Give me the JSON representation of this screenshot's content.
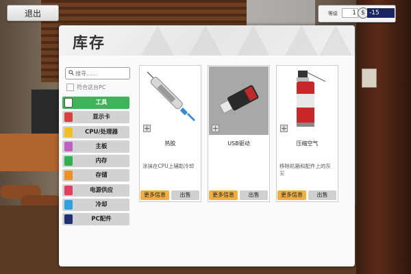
{
  "back_button": {
    "label": "退出"
  },
  "hud": {
    "level_label": "等级",
    "level": "1",
    "currency_symbol": "$",
    "money": "-15"
  },
  "window": {
    "title": "库存"
  },
  "search": {
    "placeholder": "搜寻......"
  },
  "filter": {
    "label": "符合这台PC"
  },
  "categories": [
    {
      "label": "工具",
      "active": true,
      "icon": "tools-icon",
      "color": "#3fb35a"
    },
    {
      "label": "显示卡",
      "icon": "gpu-icon",
      "color": "#d94040"
    },
    {
      "label": "CPU/处理器",
      "icon": "cpu-icon",
      "color": "#f0c020"
    },
    {
      "label": "主板",
      "icon": "motherboard-icon",
      "color": "#c060c0"
    },
    {
      "label": "内存",
      "icon": "ram-icon",
      "color": "#30b050"
    },
    {
      "label": "存储",
      "icon": "storage-icon",
      "color": "#f09020"
    },
    {
      "label": "电源供应",
      "icon": "psu-icon",
      "color": "#e04060"
    },
    {
      "label": "冷却",
      "icon": "cooling-icon",
      "color": "#30a0e0"
    },
    {
      "label": "PC配件",
      "icon": "pc-parts-icon",
      "color": "#203070"
    }
  ],
  "items": [
    {
      "name": "热胶",
      "desc": "涂抹在CPU上辅助冷却",
      "info": "更多信息",
      "sell": "出售",
      "icon": "thermal-paste-icon"
    },
    {
      "name": "USB驱动",
      "desc": "",
      "info": "更多信息",
      "sell": "出售",
      "icon": "usb-drive-icon"
    },
    {
      "name": "压缩空气",
      "desc": "移除机箱和配件上的灰尘",
      "info": "更多信息",
      "sell": "出售",
      "icon": "compressed-air-icon"
    }
  ]
}
